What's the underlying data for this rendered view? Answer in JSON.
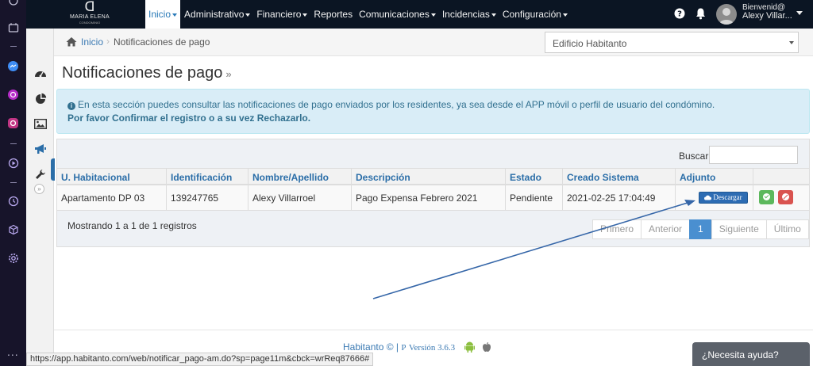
{
  "dock": {
    "icons": [
      "chevron-icon",
      "calendar-icon",
      "messenger-icon",
      "whatsapp-icon",
      "instagram-icon",
      "play-icon",
      "clock-icon",
      "cube-icon",
      "settings-icon"
    ],
    "more": "..."
  },
  "navbar": {
    "logo_mark": "ᗡ",
    "logo_name": "MARIA ELENA",
    "logo_sub": "CONDOMINIO",
    "menu": [
      "Inicio",
      "Administrativo",
      "Financiero",
      "Reportes",
      "Comunicaciones",
      "Incidencias",
      "Configuración"
    ],
    "welcome": "Bienvenid@",
    "user_name": "Alexy Villar..."
  },
  "breadcrumb": {
    "home": "Inicio",
    "current": "Notificaciones de pago",
    "separator": "›"
  },
  "building_select": {
    "value": "Edificio Habitanto"
  },
  "page": {
    "title": "Notificaciones de pago",
    "title_suffix": "»"
  },
  "alert": {
    "info_icon": "i",
    "line1": "En esta sección puedes consultar las notificaciones de pago enviados por los residentes, ya sea desde el APP móvil o perfil de usuario del condómino.",
    "line2": "Por favor Confirmar el registro o a su vez Rechazarlo."
  },
  "table": {
    "search_label": "Buscar",
    "search_value": "",
    "columns": [
      "U. Habitacional",
      "Identificación",
      "Nombre/Apellido",
      "Descripción",
      "Estado",
      "Creado Sistema",
      "Adjunto"
    ],
    "rows": [
      {
        "unit": "Apartamento DP 03",
        "id": "139247765",
        "name": "Alexy Villarroel",
        "description": "Pago Expensa Febrero 2021",
        "status": "Pendiente",
        "created": "2021-02-25 17:04:49",
        "download_label": "Descargar"
      }
    ],
    "showing": "Mostrando 1 a 1 de 1 registros",
    "pager": {
      "first": "Primero",
      "prev": "Anterior",
      "current": "1",
      "next": "Siguiente",
      "last": "Último"
    }
  },
  "footer": {
    "brand": "Habitanto ©",
    "sep": "|",
    "version": "Versión 3.6.3",
    "version_icon": "P"
  },
  "status_url": "https://app.habitanto.com/web/notificar_pago-am.do?sp=page11m&cbck=wrReq87666#",
  "help_label": "¿Necesita ayuda?",
  "colors": {
    "navbar": "#0b1523",
    "dock": "#17142a",
    "accent": "#2b6ea8",
    "alert_bg": "#d9edf7",
    "confirm": "#5cb85c",
    "reject": "#d9534f",
    "annotation_arrow": "#3566a8"
  }
}
